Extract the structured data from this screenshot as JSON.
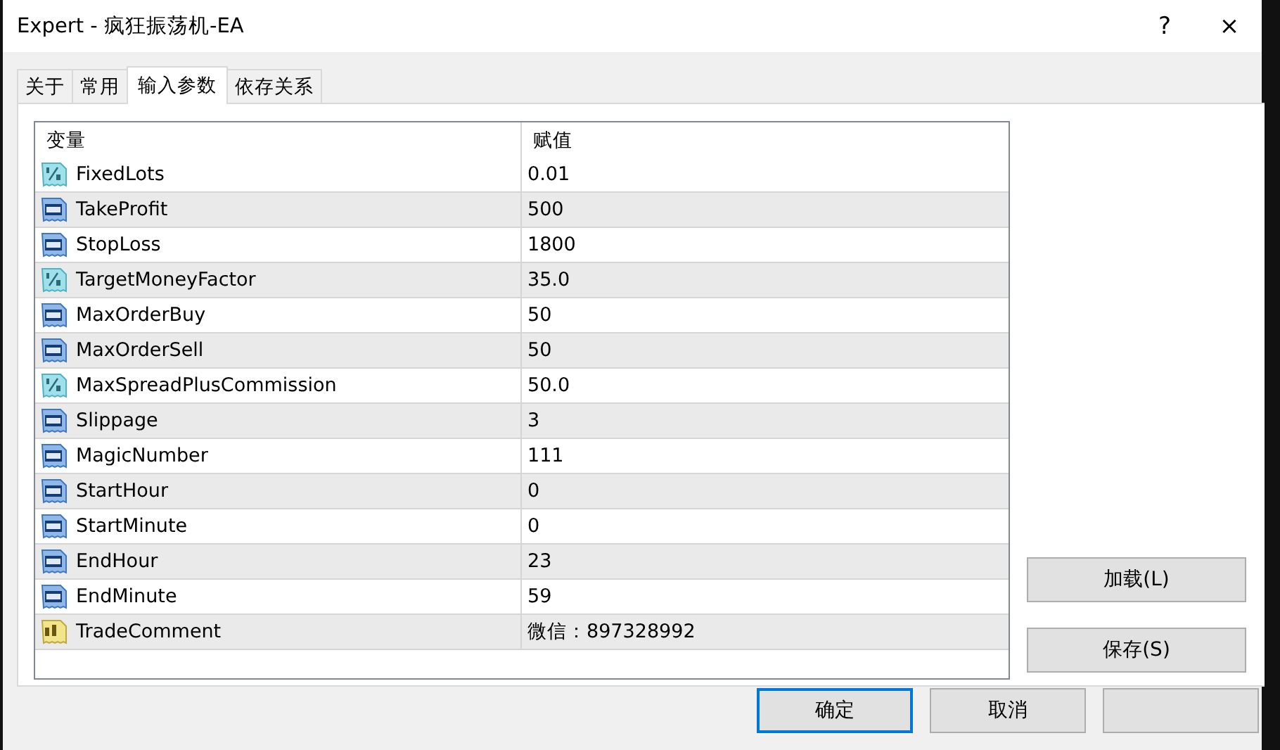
{
  "window": {
    "title": "Expert - 疯狂振荡机-EA",
    "help": "?",
    "close": "×"
  },
  "tabs": [
    {
      "label": "关于",
      "selected": false
    },
    {
      "label": "常用",
      "selected": false
    },
    {
      "label": "输入参数",
      "selected": true
    },
    {
      "label": "依存关系",
      "selected": false
    }
  ],
  "table": {
    "columns": [
      "变量",
      "赋值"
    ],
    "rows": [
      {
        "kind": "double",
        "name": "FixedLots",
        "value": "0.01"
      },
      {
        "kind": "int",
        "name": "TakeProfit",
        "value": "500"
      },
      {
        "kind": "int",
        "name": "StopLoss",
        "value": "1800"
      },
      {
        "kind": "double",
        "name": "TargetMoneyFactor",
        "value": "35.0"
      },
      {
        "kind": "int",
        "name": "MaxOrderBuy",
        "value": "50"
      },
      {
        "kind": "int",
        "name": "MaxOrderSell",
        "value": "50"
      },
      {
        "kind": "double",
        "name": "MaxSpreadPlusCommission",
        "value": "50.0"
      },
      {
        "kind": "int",
        "name": "Slippage",
        "value": "3"
      },
      {
        "kind": "int",
        "name": "MagicNumber",
        "value": "111"
      },
      {
        "kind": "int",
        "name": "StartHour",
        "value": "0"
      },
      {
        "kind": "int",
        "name": "StartMinute",
        "value": "0"
      },
      {
        "kind": "int",
        "name": "EndHour",
        "value": "23"
      },
      {
        "kind": "int",
        "name": "EndMinute",
        "value": "59"
      },
      {
        "kind": "string",
        "name": "TradeComment",
        "value": "微信：897328992"
      }
    ]
  },
  "side_buttons": [
    "加载(L)",
    "保存(S)"
  ],
  "footer_buttons": [
    {
      "label": "确定",
      "default": true
    },
    {
      "label": "取消",
      "default": false
    },
    {
      "default": false
    }
  ]
}
